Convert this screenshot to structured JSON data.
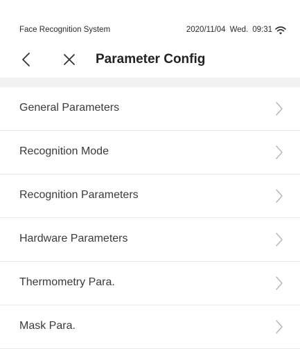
{
  "status_bar": {
    "app_name": "Face Recognition System",
    "date": "2020/11/04",
    "weekday": "Wed.",
    "time": "09:31",
    "wifi_icon": "wifi-icon"
  },
  "header": {
    "title": "Parameter Config",
    "back_icon": "back-arrow-icon",
    "close_icon": "close-icon"
  },
  "menu": {
    "items": [
      {
        "label": "General Parameters",
        "icon": "chevron-right-icon"
      },
      {
        "label": "Recognition Mode",
        "icon": "chevron-right-icon"
      },
      {
        "label": "Recognition Parameters",
        "icon": "chevron-right-icon"
      },
      {
        "label": "Hardware Parameters",
        "icon": "chevron-right-icon"
      },
      {
        "label": "Thermometry Para.",
        "icon": "chevron-right-icon"
      },
      {
        "label": "Mask Para.",
        "icon": "chevron-right-icon"
      }
    ]
  },
  "colors": {
    "background": "#ffffff",
    "separator": "#e9e9e9",
    "gap": "#f2f2f2",
    "text": "#3a3a3a",
    "chevron": "#b5b5b5"
  }
}
